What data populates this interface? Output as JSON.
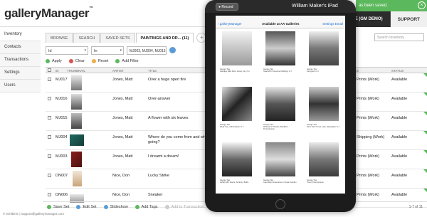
{
  "header": {
    "logo": "galleryManager",
    "logo_mark": "™",
    "company_tab": "ASSAGE (GM DEMO)",
    "support_tab": "SUPPORT",
    "toast": "as been saved."
  },
  "sidebar": {
    "items": [
      {
        "label": "Inventory"
      },
      {
        "label": "Contacts"
      },
      {
        "label": "Transactions"
      },
      {
        "label": "Settings"
      },
      {
        "label": "Users"
      }
    ]
  },
  "tabs": {
    "items": [
      {
        "label": "BROWSE"
      },
      {
        "label": "SEARCH"
      },
      {
        "label": "SAVED SETS"
      },
      {
        "label": "PAINTINGS AND DR... (11)"
      }
    ],
    "search_placeholder": "Search Inventory"
  },
  "filter": {
    "field": "Id",
    "operator": "In",
    "value": "MJ003, MJ004, MJ015"
  },
  "actions": {
    "apply": "Apply",
    "clear": "Clear",
    "reset": "Reset",
    "add_filter": "Add Filter"
  },
  "table": {
    "columns": {
      "id": "ID",
      "thumbnail": "THUMBNAIL",
      "artist": "ARTIST",
      "title": "TITLE",
      "type": "E",
      "status": "STATUS"
    },
    "rows": [
      {
        "id": "MJ017",
        "artist": "Jones, Matt",
        "title": "Over a huge open fire",
        "type": "Prints (Work)",
        "status": "Available"
      },
      {
        "id": "MJ016",
        "artist": "Jones, Matt",
        "title": "Over-answer",
        "type": "Prints (Work)",
        "status": "Available"
      },
      {
        "id": "MJ015",
        "artist": "Jones, Matt",
        "title": "A flower with six leaves",
        "type": "Prints (Work)",
        "status": "Available"
      },
      {
        "id": "MJ004",
        "artist": "Jones, Matt",
        "title": "Where do you come from and whi",
        "title2": "going?",
        "type": "Shipping (Work)",
        "status": "Available"
      },
      {
        "id": "MJ003",
        "artist": "Jones, Matt",
        "title": "I dreamt a dream!",
        "type": "Prints (Work)",
        "status": "Available"
      },
      {
        "id": "DN007",
        "artist": "Nice, Don",
        "title": "Lucky Strike",
        "type": "Prints (Work)",
        "status": "Available"
      },
      {
        "id": "DN006",
        "artist": "Nice, Don",
        "title": "Sneaker",
        "type": "Prints (Work)",
        "status": "Available"
      }
    ]
  },
  "bottombar": {
    "save_set": "Save Set",
    "edit_set": "Edit Set",
    "slideshow": "Slideshow",
    "add_tags": "Add Tags",
    "add_to_transaction": "Add to Transaction",
    "pager": "1-7 of 11"
  },
  "footer": "© exhibit-E  |  support@gallerymanager.com",
  "ipad": {
    "record": "Record",
    "device_name": "William Maker's iPad",
    "nav_back": "galleryManager",
    "nav_title": "Available at AA Galleries",
    "nav_right": "Settings   Email",
    "artworks": [
      {
        "caption": "George Tice",
        "caption2": "Garbage Mills Park, Jersey City, N.J."
      },
      {
        "caption": "George Tice",
        "caption2": "Steel Mill in Governor Building, N.Y."
      },
      {
        "caption": "George Tice",
        "caption2": "Farmyard, N.J."
      },
      {
        "caption": "George Tice",
        "caption2": "Dead Tree, Adirondacks, N.Y."
      },
      {
        "caption": "George Tice",
        "caption2": "Whitestone Theatre, Bradford, Pennsylvania"
      },
      {
        "caption": "George Tice",
        "caption2": "Diner with T-bone Lake, Springfield, N.J."
      },
      {
        "caption": "George Tice",
        "caption2": "Ashley Mill, Keene, Sunbury, Bluffs"
      },
      {
        "caption": "George Tice",
        "caption2": "Cape May Gravestone in Ocean Garden"
      },
      {
        "caption": "George Tice",
        "caption2": "Trees, Pennsylvania"
      }
    ]
  },
  "colors": {
    "green": "#5cb85c",
    "red": "#d9534f",
    "orange": "#f0ad4e",
    "blue": "#5b9bd5",
    "dark": "#2c2c2c"
  }
}
